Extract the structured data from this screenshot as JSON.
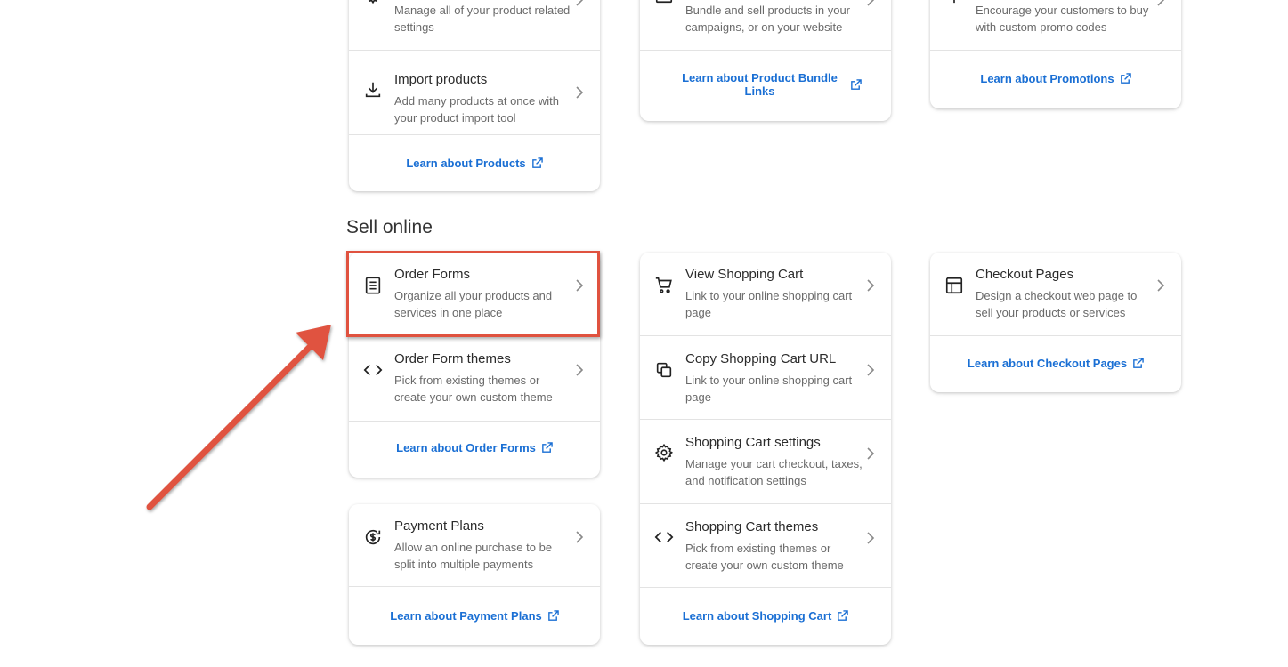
{
  "top_cards": {
    "products": {
      "rows": [
        {
          "desc": "Manage all of your product related settings"
        },
        {
          "title": "Import products",
          "desc": "Add many products at once with your product import tool"
        }
      ],
      "learn": "Learn about Products"
    },
    "bundles": {
      "rows": [
        {
          "desc": "Bundle and sell products in your campaigns, or on your website"
        }
      ],
      "learn": "Learn about Product Bundle Links"
    },
    "promotions": {
      "rows": [
        {
          "desc": "Encourage your customers to buy with custom promo codes"
        }
      ],
      "learn": "Learn about Promotions"
    }
  },
  "sell_online": {
    "heading": "Sell online",
    "order_forms": {
      "rows": [
        {
          "title": "Order Forms",
          "desc": "Organize all your products and services in one place"
        },
        {
          "title": "Order Form themes",
          "desc": "Pick from existing themes or create your own custom theme"
        }
      ],
      "learn": "Learn about Order Forms"
    },
    "payment_plans": {
      "rows": [
        {
          "title": "Payment Plans",
          "desc": "Allow an online purchase to be split into multiple payments"
        }
      ],
      "learn": "Learn about Payment Plans"
    },
    "shopping_cart": {
      "rows": [
        {
          "title": "View Shopping Cart",
          "desc": "Link to your online shopping cart page"
        },
        {
          "title": "Copy Shopping Cart URL",
          "desc": "Link to your online shopping cart page"
        },
        {
          "title": "Shopping Cart settings",
          "desc": "Manage your cart checkout, taxes, and notification settings"
        },
        {
          "title": "Shopping Cart themes",
          "desc": "Pick from existing themes or create your own custom theme"
        }
      ],
      "learn": "Learn about Shopping Cart"
    },
    "checkout_pages": {
      "rows": [
        {
          "title": "Checkout Pages",
          "desc": "Design a checkout web page to sell your products or services"
        }
      ],
      "learn": "Learn about Checkout Pages"
    }
  },
  "annotation": {
    "highlight_color": "#e0523f",
    "link_color": "#1a6fd4"
  }
}
